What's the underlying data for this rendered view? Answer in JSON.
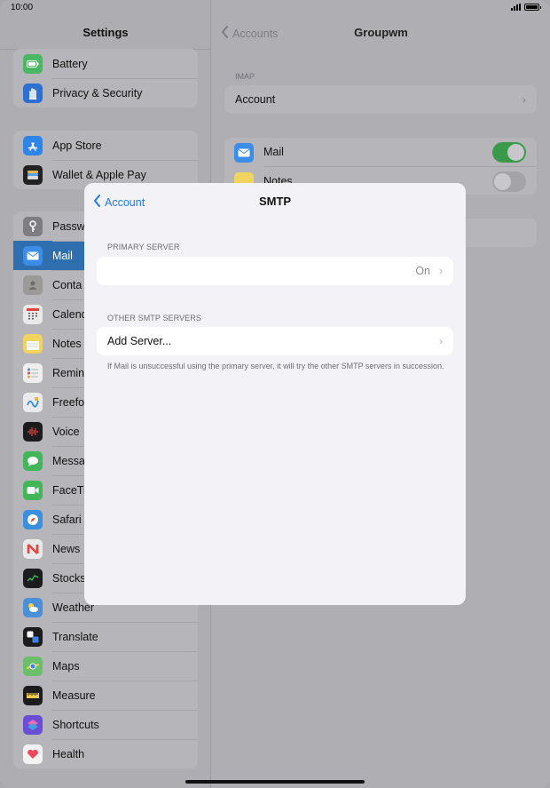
{
  "status_bar": {
    "time": "10:00"
  },
  "sidebar": {
    "title": "Settings",
    "groups": [
      {
        "items": [
          {
            "label": "Battery",
            "icon": "battery-icon",
            "color": "#4ab862"
          },
          {
            "label": "Privacy & Security",
            "icon": "hand-icon",
            "color": "#2d6fd3"
          }
        ]
      },
      {
        "items": [
          {
            "label": "App Store",
            "icon": "app-store-icon",
            "color": "#2f84e8"
          },
          {
            "label": "Wallet & Apple Pay",
            "icon": "wallet-icon",
            "color": "#222222"
          }
        ]
      },
      {
        "items": [
          {
            "label": "Passw",
            "icon": "key-icon",
            "color": "#7d7d82"
          },
          {
            "label": "Mail",
            "icon": "mail-icon",
            "color": "#3b8de8",
            "selected": true
          },
          {
            "label": "Conta",
            "icon": "contacts-icon",
            "color": "#9c9a97"
          },
          {
            "label": "Calend",
            "icon": "calendar-icon",
            "color": "#e9e9ea"
          },
          {
            "label": "Notes",
            "icon": "notes-icon",
            "color": "#f1d35f"
          },
          {
            "label": "Remin",
            "icon": "reminders-icon",
            "color": "#efeff0"
          },
          {
            "label": "Freefo",
            "icon": "freeform-icon",
            "color": "#ebebed"
          },
          {
            "label": "Voice",
            "icon": "voice-memos-icon",
            "color": "#1c1c1e"
          },
          {
            "label": "Messa",
            "icon": "messages-icon",
            "color": "#43b65a"
          },
          {
            "label": "FaceTi",
            "icon": "facetime-icon",
            "color": "#43b65a"
          },
          {
            "label": "Safari",
            "icon": "safari-icon",
            "color": "#3a8fe0"
          },
          {
            "label": "News",
            "icon": "news-icon",
            "color": "#e9e9ea"
          },
          {
            "label": "Stocks",
            "icon": "stocks-icon",
            "color": "#1c1c1e"
          },
          {
            "label": "Weather",
            "icon": "weather-icon",
            "color": "#4a90d9"
          },
          {
            "label": "Translate",
            "icon": "translate-icon",
            "color": "#1c1c1e"
          },
          {
            "label": "Maps",
            "icon": "maps-icon",
            "color": "#6bbf6a"
          },
          {
            "label": "Measure",
            "icon": "measure-icon",
            "color": "#1c1c1e"
          },
          {
            "label": "Shortcuts",
            "icon": "shortcuts-icon",
            "color": "#6a4fd6"
          },
          {
            "label": "Health",
            "icon": "health-icon",
            "color": "#f3f3f4"
          }
        ]
      }
    ]
  },
  "detail": {
    "back_label": "Accounts",
    "title": "Groupwm",
    "section_caption": "IMAP",
    "account_label": "Account",
    "services": [
      {
        "label": "Mail",
        "icon": "mail-icon",
        "on": true
      },
      {
        "label": "Notes",
        "icon": "notes-icon",
        "on": false
      }
    ]
  },
  "modal": {
    "back_label": "Account",
    "title": "SMTP",
    "primary_caption": "PRIMARY SERVER",
    "primary_value": "On",
    "other_caption": "OTHER SMTP SERVERS",
    "add_server_label": "Add Server...",
    "footnote": "If Mail is unsuccessful using the primary server, it will try the other SMTP servers in succession."
  },
  "colors": {
    "accent": "#1f7cf0",
    "toggle_on": "#3a9a4a"
  }
}
